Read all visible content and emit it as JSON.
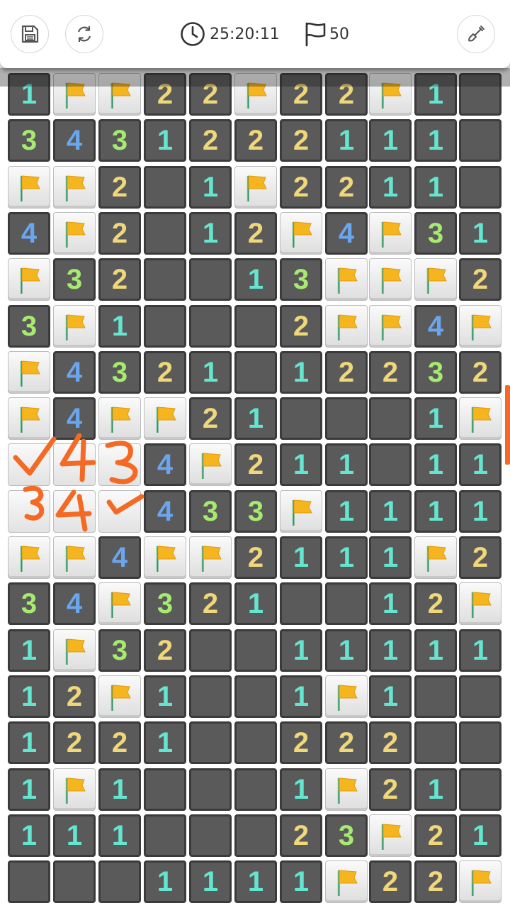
{
  "header": {
    "timer": "25:20:11",
    "flags": "50",
    "icons": {
      "save": "save-icon",
      "restart": "refresh-icon",
      "clock": "clock-icon",
      "flag": "flag-outline-icon",
      "shovel": "shovel-icon"
    }
  },
  "colors": {
    "one": "#64e5d0",
    "two": "#f0d77a",
    "three": "#a6ea6f",
    "four": "#6aa6ee",
    "flag": "#f5b51f",
    "annotation": "#f46a25"
  },
  "board": {
    "legend": "F = flag, B = unrevealed tile, . = empty revealed, digit = count",
    "rows": [
      [
        "1",
        "F",
        "F",
        "2",
        "2",
        "F",
        "2",
        "2",
        "F",
        "1",
        "."
      ],
      [
        "3",
        "4",
        "3",
        "1",
        "2",
        "2",
        "2",
        "1",
        "1",
        "1",
        "."
      ],
      [
        "F",
        "F",
        "2",
        ".",
        "1",
        "F",
        "2",
        "2",
        "1",
        "1",
        "."
      ],
      [
        "4",
        "F",
        "2",
        ".",
        "1",
        "2",
        "F",
        "4",
        "F",
        "3",
        "1"
      ],
      [
        "F",
        "3",
        "2",
        ".",
        ".",
        "1",
        "3",
        "F",
        "F",
        "F",
        "2"
      ],
      [
        "3",
        "F",
        "1",
        ".",
        ".",
        ".",
        "2",
        "F",
        "F",
        "4",
        "F"
      ],
      [
        "F",
        "4",
        "3",
        "2",
        "1",
        ".",
        "1",
        "2",
        "2",
        "3",
        "2"
      ],
      [
        "F",
        "4",
        "F",
        "F",
        "2",
        "1",
        ".",
        ".",
        ".",
        "1",
        "F"
      ],
      [
        "B",
        "B",
        "B",
        "4",
        "F",
        "2",
        "1",
        "1",
        ".",
        "1",
        "1"
      ],
      [
        "B",
        "B",
        "B",
        "4",
        "3",
        "3",
        "F",
        "1",
        "1",
        "1",
        "1"
      ],
      [
        "F",
        "F",
        "4",
        "F",
        "F",
        "2",
        "1",
        "1",
        "1",
        "F",
        "2"
      ],
      [
        "3",
        "4",
        "F",
        "3",
        "2",
        "1",
        ".",
        ".",
        "1",
        "2",
        "F"
      ],
      [
        "1",
        "F",
        "3",
        "2",
        ".",
        ".",
        "1",
        "1",
        "1",
        "1",
        "1"
      ],
      [
        "1",
        "2",
        "F",
        "1",
        ".",
        ".",
        "1",
        "F",
        "1",
        ".",
        "."
      ],
      [
        "1",
        "2",
        "2",
        "1",
        ".",
        ".",
        "2",
        "2",
        "2",
        ".",
        "."
      ],
      [
        "1",
        "F",
        "1",
        ".",
        ".",
        ".",
        "1",
        "F",
        "2",
        "1",
        "."
      ],
      [
        "1",
        "1",
        "1",
        ".",
        ".",
        ".",
        "2",
        "3",
        "F",
        "2",
        "1"
      ],
      [
        ".",
        ".",
        ".",
        "1",
        "1",
        "1",
        "1",
        "F",
        "2",
        "2",
        "F"
      ]
    ]
  },
  "annotations": {
    "row9": [
      "✓",
      "4",
      "3"
    ],
    "row10": [
      "3",
      "4",
      "✓"
    ]
  }
}
